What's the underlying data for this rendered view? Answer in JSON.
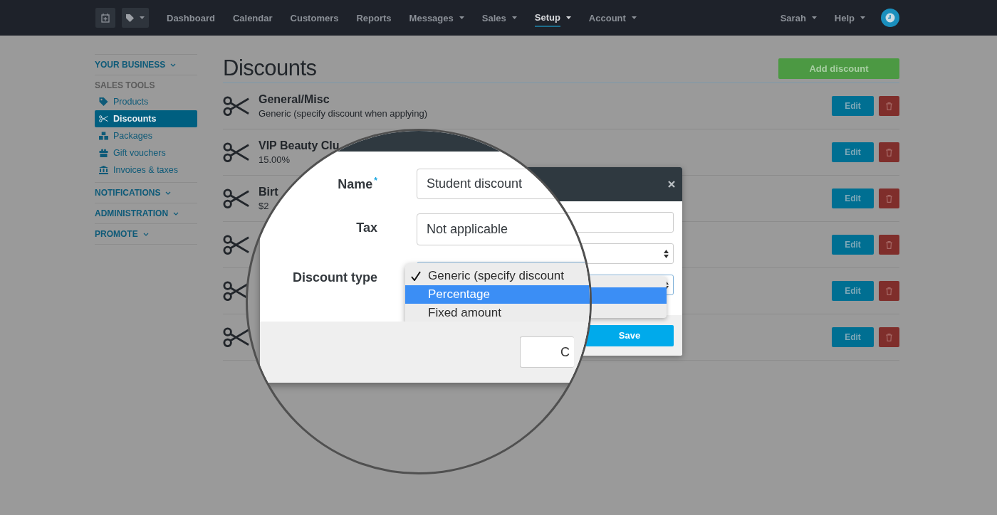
{
  "nav": {
    "items": [
      {
        "label": "Dashboard",
        "dropdown": false,
        "selected": false
      },
      {
        "label": "Calendar",
        "dropdown": false,
        "selected": false
      },
      {
        "label": "Customers",
        "dropdown": false,
        "selected": false
      },
      {
        "label": "Reports",
        "dropdown": false,
        "selected": false
      },
      {
        "label": "Messages",
        "dropdown": true,
        "selected": false
      },
      {
        "label": "Sales",
        "dropdown": true,
        "selected": false
      },
      {
        "label": "Setup",
        "dropdown": true,
        "selected": true
      },
      {
        "label": "Account",
        "dropdown": true,
        "selected": false
      }
    ],
    "right": [
      {
        "label": "Sarah"
      },
      {
        "label": "Help"
      }
    ]
  },
  "sidebar": [
    {
      "label": "YOUR BUSINESS",
      "kind": "menu"
    },
    {
      "label": "SALES TOOLS",
      "kind": "heading",
      "items": [
        {
          "label": "Products",
          "kind": "tag",
          "selected": false
        },
        {
          "label": "Discounts",
          "kind": "scissors",
          "selected": true
        },
        {
          "label": "Packages",
          "kind": "cubes",
          "selected": false
        },
        {
          "label": "Gift vouchers",
          "kind": "gift",
          "selected": false
        },
        {
          "label": "Invoices & taxes",
          "kind": "bank",
          "selected": false
        }
      ]
    },
    {
      "label": "NOTIFICATIONS",
      "kind": "menu"
    },
    {
      "label": "ADMINISTRATION",
      "kind": "menu"
    },
    {
      "label": "PROMOTE",
      "kind": "menu"
    }
  ],
  "page": {
    "title": "Discounts",
    "add_button": "Add discount"
  },
  "discounts": [
    {
      "name": "General/Misc",
      "detail": "Generic (specify discount when applying)",
      "edit": "Edit"
    },
    {
      "name": "VIP Beauty Clu",
      "detail": "15.00%",
      "edit": "Edit"
    },
    {
      "name": "Birt",
      "detail": "$2",
      "edit": "Edit"
    },
    {
      "edit": "Edit"
    },
    {
      "edit": "Edit"
    },
    {
      "edit": "Edit"
    }
  ],
  "dialog": {
    "save_button": "Save",
    "cancel_button": "C",
    "fields": [
      {
        "label": "Name$^{*}$",
        "value": "Student discount"
      },
      {
        "label": "Tax",
        "value": "Not applicable"
      },
      {
        "label": "Discount type"
      }
    ],
    "options": [
      {
        "label": "Generic (specify discount",
        "checked": true,
        "selected": false
      },
      {
        "label": "Percentage",
        "checked": false,
        "selected": true
      },
      {
        "label": "Fixed amount",
        "checked": false,
        "selected": false
      }
    ]
  }
}
